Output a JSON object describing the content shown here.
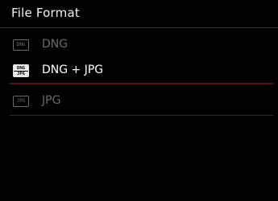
{
  "header": {
    "title": "File Format"
  },
  "options": [
    {
      "label": "DNG",
      "icon": "dng-icon",
      "icon_text": "DNG",
      "selected": false
    },
    {
      "label": "DNG + JPG",
      "icon": "dng-jpg-icon",
      "icon_text_top": "DNG",
      "icon_text_bottom": "JPG",
      "selected": true
    },
    {
      "label": "JPG",
      "icon": "jpg-icon",
      "icon_text": "JPG",
      "selected": false
    }
  ],
  "colors": {
    "background": "#000000",
    "selected_text": "#ffffff",
    "unselected_text": "#6a6a6a",
    "selection_line": "#5e1018"
  }
}
